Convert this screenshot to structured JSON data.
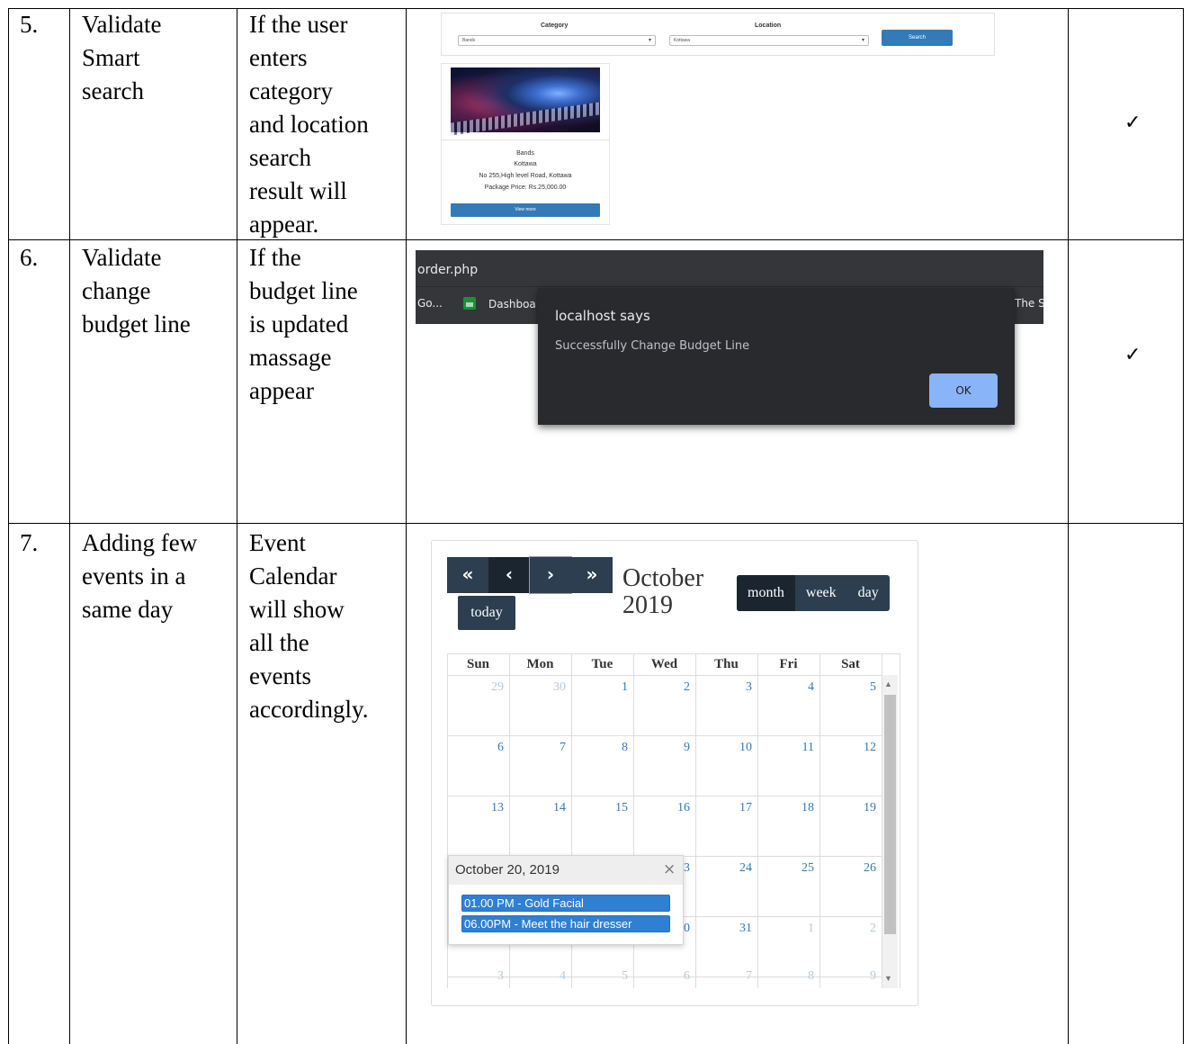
{
  "rows": [
    {
      "num": "5.",
      "scenario": [
        "Validate",
        "Smart",
        "search"
      ],
      "expected": [
        "If the user",
        "enters",
        "category",
        "and location",
        "search",
        "result will",
        "appear."
      ],
      "result": "✓"
    },
    {
      "num": "6.",
      "scenario": [
        "Validate",
        "change",
        "budget line"
      ],
      "expected": [
        "If the",
        "budget line",
        "is updated",
        "massage",
        "appear"
      ],
      "result": "✓"
    },
    {
      "num": "7.",
      "scenario": [
        "Adding few",
        "events in a",
        "same day"
      ],
      "expected": [
        "Event",
        "Calendar",
        "will show",
        "all the",
        "events",
        "accordingly."
      ],
      "result": ""
    }
  ],
  "smart_search": {
    "category_label": "Category",
    "location_label": "Location",
    "category_value": "Bands",
    "location_value": "Kottawa",
    "search_button": "Search",
    "card": {
      "title": "Bands",
      "location": "Kottawa",
      "address": "No 255,High level Road, Kottawa",
      "price": "Package Price: Rs.25,000.00",
      "button": "View more"
    }
  },
  "browser_alert": {
    "url_text": "order.php",
    "bookmark_left": "Go...",
    "bookmark_dashboard": "Dashboa",
    "bookmark_right": "The S",
    "dialog_title": "localhost says",
    "dialog_message": "Successfully Change Budget Line",
    "ok_button": "OK"
  },
  "calendar": {
    "nav": {
      "prev_year": "«",
      "prev": "‹",
      "next": "›",
      "next_year": "»"
    },
    "today_button": "today",
    "title_line1": "October",
    "title_line2": "2019",
    "views": [
      "month",
      "week",
      "day"
    ],
    "active_view": "month",
    "weekdays": [
      "Sun",
      "Mon",
      "Tue",
      "Wed",
      "Thu",
      "Fri",
      "Sat"
    ],
    "weeks": [
      [
        "29",
        "30",
        "1",
        "2",
        "3",
        "4",
        "5"
      ],
      [
        "6",
        "7",
        "8",
        "9",
        "10",
        "11",
        "12"
      ],
      [
        "13",
        "14",
        "15",
        "16",
        "17",
        "18",
        "19"
      ],
      [
        "",
        "",
        "",
        "3",
        "24",
        "25",
        "26"
      ],
      [
        "",
        "",
        "",
        "0",
        "31",
        "1",
        "2"
      ],
      [
        "3",
        "4",
        "5",
        "6",
        "7",
        "8",
        "9"
      ]
    ],
    "popover": {
      "title": "October 20, 2019",
      "close": "×",
      "events": [
        "01.00 PM - Gold Facial",
        "06.00PM - Meet the hair dresser"
      ]
    }
  }
}
